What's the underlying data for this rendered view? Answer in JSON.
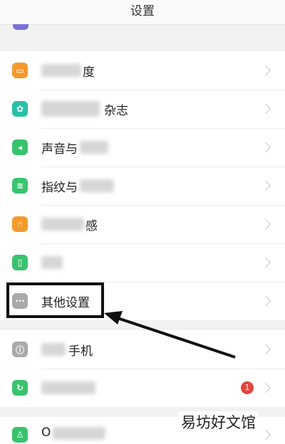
{
  "header": {
    "title": "设置"
  },
  "rows": [
    {
      "id": "display",
      "label_visible": "度",
      "icon": "display-icon",
      "color": "#f39a2b"
    },
    {
      "id": "magazine",
      "label_visible": "杂志",
      "icon": "pinwheel-icon",
      "color": "#28c0a8"
    },
    {
      "id": "sound",
      "label_visible": "声音与",
      "icon": "speaker-icon",
      "color": "#39c26e"
    },
    {
      "id": "fingerprint",
      "label_visible": "指纹与",
      "icon": "fingerprint-icon",
      "color": "#39c26e"
    },
    {
      "id": "gesture",
      "label_visible": "感",
      "icon": "hand-tap-icon",
      "color": "#f39a2b"
    },
    {
      "id": "battery",
      "label_visible": "",
      "icon": "battery-icon",
      "color": "#39c26e"
    },
    {
      "id": "other",
      "label_visible": "其他设置",
      "icon": "more-dots-icon",
      "color": "#a9a9a9"
    },
    {
      "id": "about",
      "label_visible": "手机",
      "icon": "info-icon",
      "color": "#a9a9a9"
    },
    {
      "id": "update",
      "label_visible": "",
      "icon": "update-icon",
      "color": "#39c26e",
      "badge": "1"
    },
    {
      "id": "account",
      "label_visible": "O",
      "icon": "person-icon",
      "color": "#39c26e"
    }
  ],
  "watermark": "易坊好文馆"
}
